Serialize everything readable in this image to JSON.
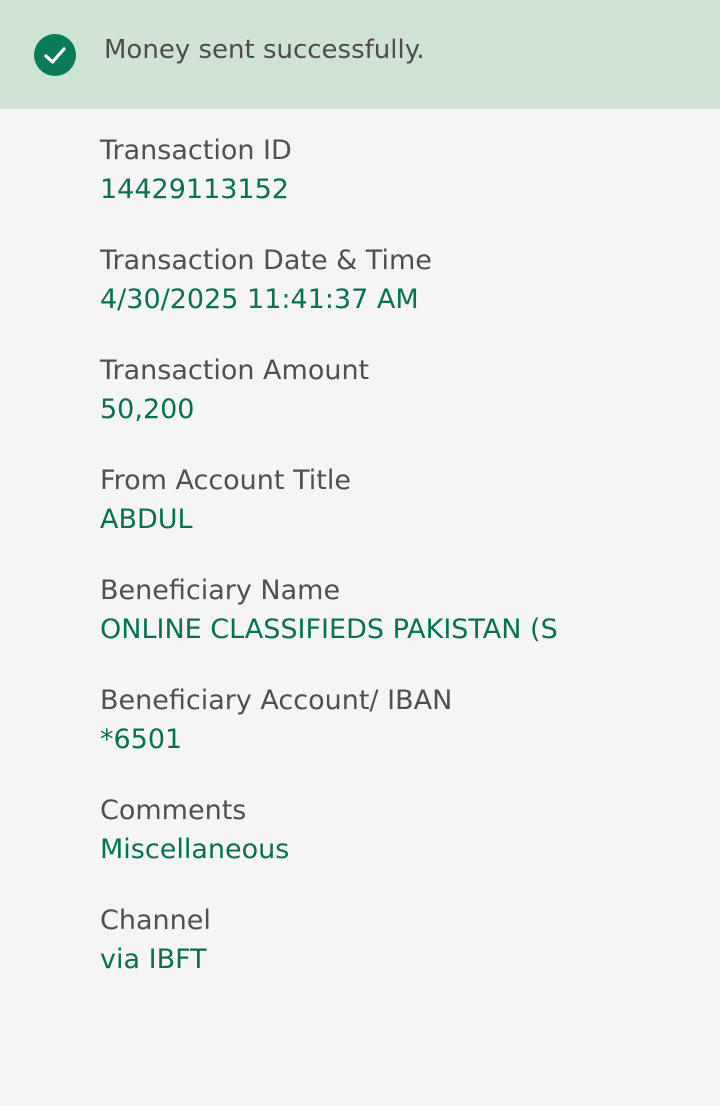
{
  "banner": {
    "message": "Money sent successfully.",
    "icon": "check-circle-icon",
    "background": "#cfe3d5",
    "accent": "#0b7a58"
  },
  "details": [
    {
      "label": "Transaction ID",
      "value": "14429113152"
    },
    {
      "label": "Transaction Date & Time",
      "value": "4/30/2025 11:41:37 AM"
    },
    {
      "label": "Transaction Amount",
      "value": "50,200"
    },
    {
      "label": "From Account Title",
      "value": "ABDUL"
    },
    {
      "label": "Beneficiary Name",
      "value": "ONLINE CLASSIFIEDS PAKISTAN (S"
    },
    {
      "label": "Beneficiary Account/ IBAN",
      "value": "*6501"
    },
    {
      "label": "Comments",
      "value": "Miscellaneous"
    },
    {
      "label": "Channel",
      "value": "via IBFT"
    }
  ],
  "colors": {
    "label": "#505050",
    "value": "#087050",
    "page_background": "#f5f5f5"
  }
}
